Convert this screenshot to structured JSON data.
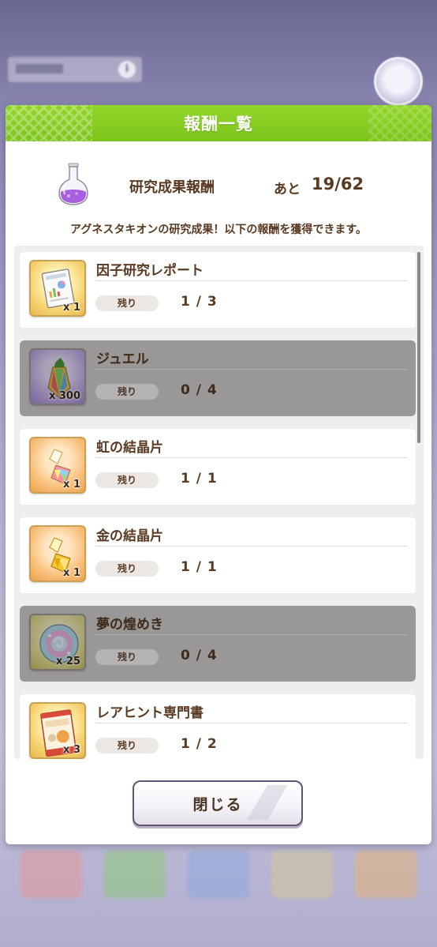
{
  "background": {
    "topbar_label": "因子研究",
    "info_label": "i"
  },
  "dialog": {
    "title": "報酬一覧",
    "summary_label": "研究成果報酬",
    "remaining_prefix": "あと",
    "remaining_value": "19/62",
    "description": "アグネスタキオンの研究成果！以下の報酬を獲得できます。",
    "remaining_label": "残り",
    "close_label": "閉じる"
  },
  "rewards": [
    {
      "name": "因子研究レポート",
      "qty": "x 1",
      "remaining": "1 / 3",
      "done": false,
      "icon": "report-icon"
    },
    {
      "name": "ジュエル",
      "qty": "x 300",
      "remaining": "0 / 4",
      "done": true,
      "icon": "jewel-icon"
    },
    {
      "name": "虹の結晶片",
      "qty": "x 1",
      "remaining": "1 / 1",
      "done": false,
      "icon": "rainbow-crystal-icon"
    },
    {
      "name": "金の結晶片",
      "qty": "x 1",
      "remaining": "1 / 1",
      "done": false,
      "icon": "gold-crystal-icon"
    },
    {
      "name": "夢の煌めき",
      "qty": "x 25",
      "remaining": "0 / 4",
      "done": true,
      "icon": "dream-sparkle-icon"
    },
    {
      "name": "レアヒント専門書",
      "qty": "x 3",
      "remaining": "1 / 2",
      "done": false,
      "icon": "hint-book-icon"
    }
  ],
  "colors": {
    "header_green": "#86cc22",
    "text_brown": "#5a3a23",
    "done_gray": "#9a9797"
  }
}
